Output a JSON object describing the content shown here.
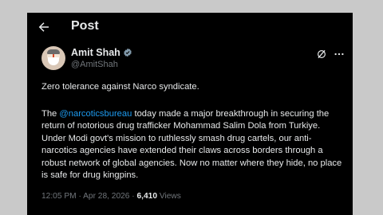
{
  "header": {
    "title": "Post"
  },
  "author": {
    "name": "Amit Shah",
    "handle": "@AmitShah"
  },
  "post": {
    "line1": "Zero tolerance against Narco syndicate.",
    "lead": "The ",
    "mention": "@narcoticsbureau",
    "body": " today made a major breakthrough in securing the return of notorious drug trafficker Mohammad Salim Dola from Turkiye. Under Modi govt's mission to ruthlessly smash drug cartels, our anti-narcotics agencies have extended their claws across borders through a robust network of global agencies. Now no matter where they hide, no place is safe for drug kingpins."
  },
  "meta": {
    "time": "12:05 PM",
    "separator": " · ",
    "date": "Apr 28, 2026",
    "views_count": "6,410",
    "views_label": " Views"
  },
  "colors": {
    "background": "#000000",
    "text": "#e7e9ea",
    "secondary": "#71767b",
    "link": "#1d9bf0",
    "verified": "#829aab"
  },
  "icons": {
    "back": "arrow-left-icon",
    "verified": "verified-badge-icon",
    "grok": "grok-icon",
    "more": "more-icon"
  }
}
